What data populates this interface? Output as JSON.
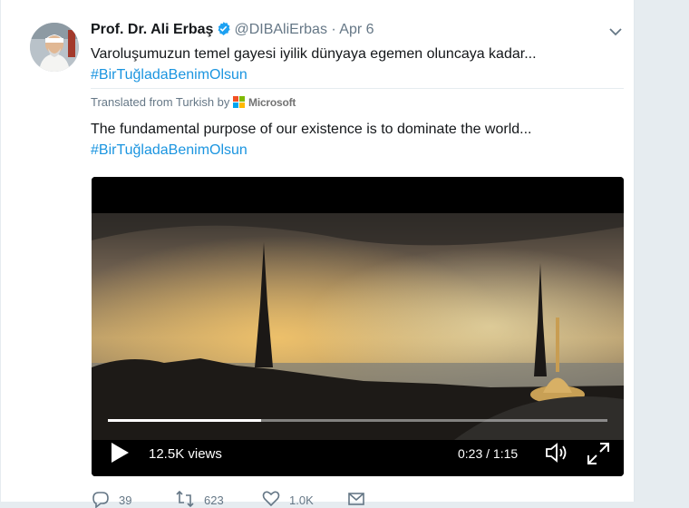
{
  "tweet": {
    "author_name": "Prof. Dr. Ali Erbaş",
    "handle": "@DIBAliErbas",
    "separator": "·",
    "date": "Apr 6",
    "text": "Varoluşumuzun temel gayesi iyilik dünyaya egemen oluncaya kadar...",
    "hashtag": "#BirTuğladaBenimOlsun"
  },
  "translation": {
    "label": "Translated from Turkish by",
    "provider": "Microsoft",
    "text": "The fundamental purpose of our existence is to dominate the world...",
    "hashtag": "#BirTuğladaBenimOlsun"
  },
  "video": {
    "views": "12.5K views",
    "time": "0:23 / 1:15",
    "progress_fraction": 0.307
  },
  "actions": {
    "replies": "39",
    "retweets": "623",
    "likes": "1.0K"
  },
  "colors": {
    "hashtag": "#1b95e0",
    "verified": "#1da1f2",
    "muted": "#657786"
  },
  "icons": [
    "verified-badge-icon",
    "chevron-down-icon",
    "microsoft-logo-icon",
    "play-icon",
    "volume-icon",
    "fullscreen-icon",
    "reply-icon",
    "retweet-icon",
    "like-icon",
    "message-icon"
  ]
}
